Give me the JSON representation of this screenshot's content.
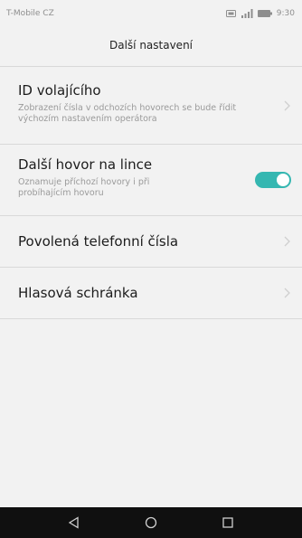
{
  "status_bar": {
    "carrier": "T-Mobile CZ",
    "time": "9:30",
    "icons": [
      "sim-icon",
      "signal-icon",
      "battery-icon"
    ]
  },
  "header": {
    "title": "Další nastavení"
  },
  "settings": [
    {
      "title": "ID volajícího",
      "subtitle": "Zobrazení čísla v odchozích hovorech se bude řídit výchozím nastavením operátora",
      "control": "chevron"
    },
    {
      "title": "Další hovor na lince",
      "subtitle": "Oznamuje příchozí hovory i při probíhajícím hovoru",
      "control": "toggle",
      "toggle_on": true
    },
    {
      "title": "Povolená telefonní čísla",
      "control": "chevron"
    },
    {
      "title": "Hlasová schránka",
      "control": "chevron"
    }
  ],
  "nav_bar": {
    "buttons": [
      "back-icon",
      "home-icon",
      "recents-icon"
    ]
  },
  "colors": {
    "accent": "#35b7b1",
    "background": "#f2f2f2",
    "nav_bar": "#101010"
  }
}
